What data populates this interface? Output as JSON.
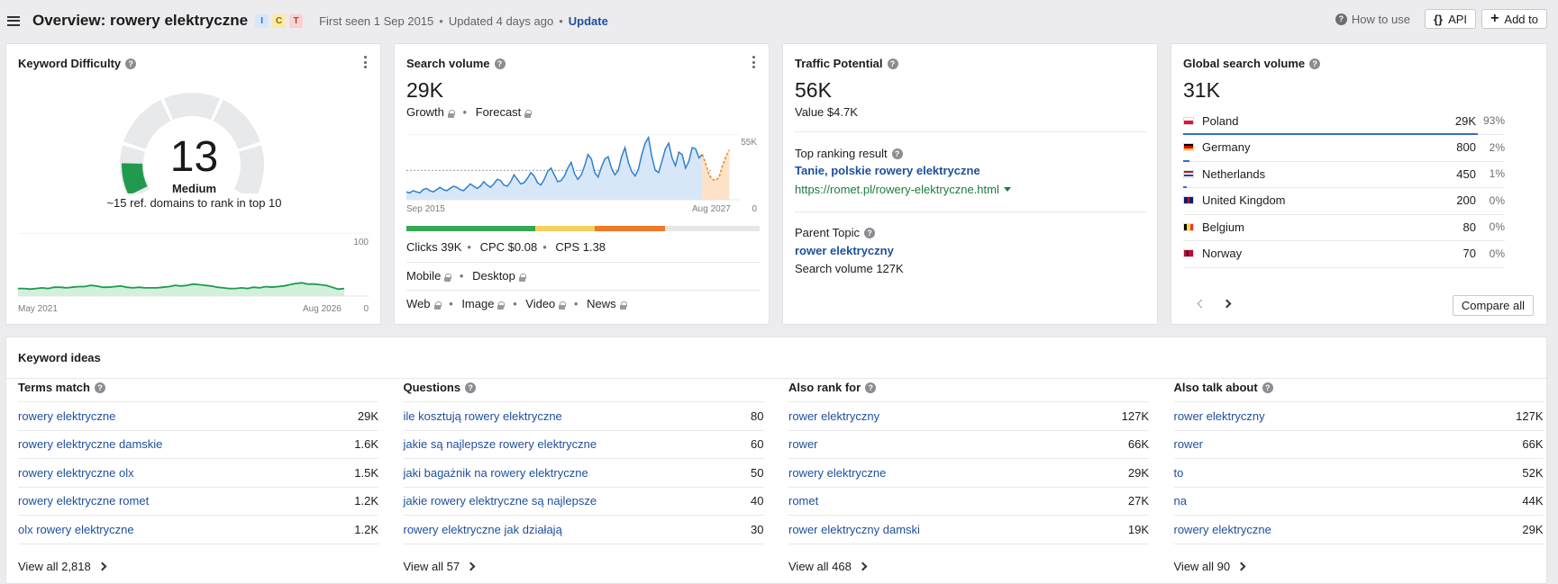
{
  "header": {
    "title": "Overview: rowery elektryczne",
    "intents": [
      "I",
      "C",
      "T"
    ],
    "first_seen": "First seen 1 Sep 2015",
    "updated": "Updated 4 days ago",
    "update_link": "Update",
    "how_to_use": "How to use",
    "api_label": "API",
    "add_to_label": "Add to"
  },
  "kd": {
    "title": "Keyword Difficulty",
    "value": "13",
    "level": "Medium",
    "note": "~15 ref. domains to rank in top 10",
    "chart_ymax": "100",
    "chart_ymin": "0",
    "chart_start": "May 2021",
    "chart_end": "Aug 2026"
  },
  "sv": {
    "title": "Search volume",
    "value": "29K",
    "growth": "Growth",
    "forecast": "Forecast",
    "chart_ymax": "55K",
    "chart_ymin": "0",
    "chart_start": "Sep 2015",
    "chart_end": "Aug 2027",
    "clicks": "Clicks 39K",
    "cpc": "CPC $0.08",
    "cps": "CPS 1.38",
    "mobile": "Mobile",
    "desktop": "Desktop",
    "web": "Web",
    "image": "Image",
    "video": "Video",
    "news": "News"
  },
  "tp": {
    "title": "Traffic Potential",
    "value": "56K",
    "value_usd": "Value $4.7K",
    "top_ranking_label": "Top ranking result",
    "top_ranking_title": "Tanie, polskie rowery elektryczne",
    "top_ranking_url": "https://romet.pl/rowery-elektryczne.html",
    "parent_topic_label": "Parent Topic",
    "parent_topic": "rower elektryczny",
    "parent_volume": "Search volume 127K"
  },
  "gsv": {
    "title": "Global search volume",
    "value": "31K",
    "rows": [
      {
        "country": "Poland",
        "volume": "29K",
        "pct": "93%",
        "share": 0.93
      },
      {
        "country": "Germany",
        "volume": "800",
        "pct": "2%",
        "share": 0.02
      },
      {
        "country": "Netherlands",
        "volume": "450",
        "pct": "1%",
        "share": 0.01
      },
      {
        "country": "United Kingdom",
        "volume": "200",
        "pct": "0%",
        "share": 0
      },
      {
        "country": "Belgium",
        "volume": "80",
        "pct": "0%",
        "share": 0
      },
      {
        "country": "Norway",
        "volume": "70",
        "pct": "0%",
        "share": 0
      }
    ],
    "compare_all": "Compare all"
  },
  "ideas": {
    "title": "Keyword ideas",
    "columns": [
      {
        "heading": "Terms match",
        "rows": [
          {
            "kw": "rowery elektryczne",
            "vol": "29K"
          },
          {
            "kw": "rowery elektryczne damskie",
            "vol": "1.6K"
          },
          {
            "kw": "rowery elektryczne olx",
            "vol": "1.5K"
          },
          {
            "kw": "rowery elektryczne romet",
            "vol": "1.2K"
          },
          {
            "kw": "olx rowery elektryczne",
            "vol": "1.2K"
          }
        ],
        "view_all": "View all 2,818"
      },
      {
        "heading": "Questions",
        "rows": [
          {
            "kw": "ile kosztują rowery elektryczne",
            "vol": "80"
          },
          {
            "kw": "jakie są najlepsze rowery elektryczne",
            "vol": "60"
          },
          {
            "kw": "jaki bagażnik na rowery elektryczne",
            "vol": "50"
          },
          {
            "kw": "jakie rowery elektryczne są najlepsze",
            "vol": "40"
          },
          {
            "kw": "rowery elektryczne jak działają",
            "vol": "30"
          }
        ],
        "view_all": "View all 57"
      },
      {
        "heading": "Also rank for",
        "rows": [
          {
            "kw": "rower elektryczny",
            "vol": "127K"
          },
          {
            "kw": "rower",
            "vol": "66K"
          },
          {
            "kw": "rowery elektryczne",
            "vol": "29K"
          },
          {
            "kw": "romet",
            "vol": "27K"
          },
          {
            "kw": "rower elektryczny damski",
            "vol": "19K"
          }
        ],
        "view_all": "View all 468"
      },
      {
        "heading": "Also talk about",
        "rows": [
          {
            "kw": "rower elektryczny",
            "vol": "127K"
          },
          {
            "kw": "rower",
            "vol": "66K"
          },
          {
            "kw": "to",
            "vol": "52K"
          },
          {
            "kw": "na",
            "vol": "44K"
          },
          {
            "kw": "rowery elektryczne",
            "vol": "29K"
          }
        ],
        "view_all": "View all 90"
      }
    ]
  },
  "colors": {
    "link": "#1e4f9c",
    "kd_green": "#1f9a4f",
    "sv_blue": "#2f80cf",
    "forecast_orange": "#f08a24",
    "bar_green": "#34a853",
    "bar_yellow": "#f4d160",
    "bar_orange": "#ee7a2a"
  }
}
